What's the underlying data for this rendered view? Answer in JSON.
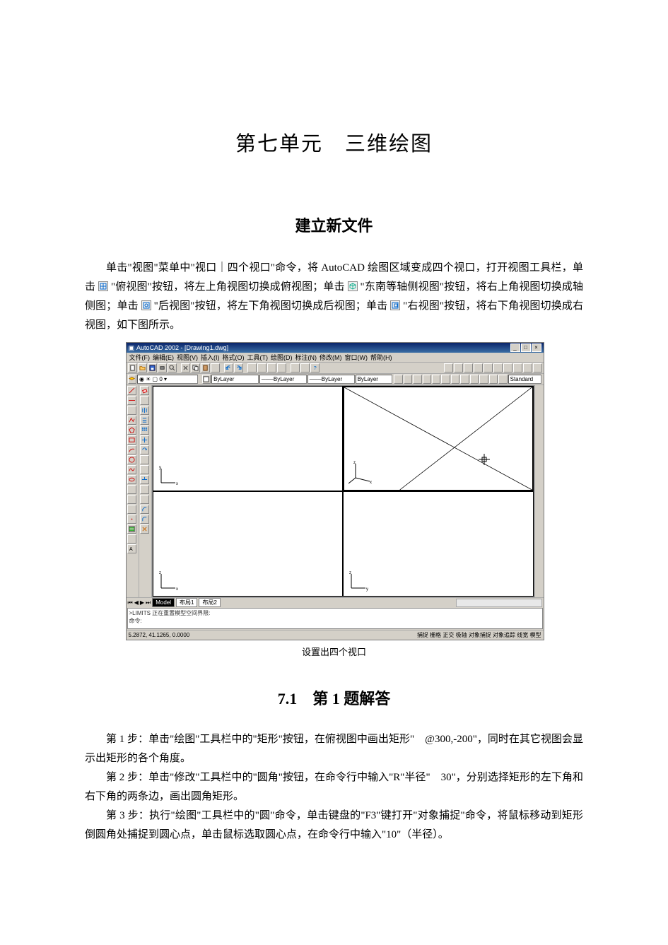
{
  "unit_title": "第七单元　三维绘图",
  "subtitle": "建立新文件",
  "intro": {
    "p1a": "单击\"视图\"菜单中\"视口｜四个视口\"命令，将 AutoCAD 绘图区域变成四个视口，打开视图工具栏，单击",
    "p1b": "\"俯视图\"按钮，将左上角视图切换成俯视图；单击",
    "p1c": "\"东南等轴侧视图\"按钮，将右上角视图切换成轴侧图；单击",
    "p1d": "\"后视图\"按钮，将左下角视图切换成后视图；单击",
    "p1e": "\"右视图\"按钮，将右下角视图切换成右视图，如下图所示。"
  },
  "figure_caption": "设置出四个视口",
  "section_title": "7.1　第 1 题解答",
  "steps": {
    "s1": "第 1 步：单击\"绘图\"工具栏中的\"矩形\"按钮，在俯视图中画出矩形\"　@300,-200\"，同时在其它视图会显示出矩形的各个角度。",
    "s2": "第 2 步：单击\"修改\"工具栏中的\"圆角\"按钮，在命令行中输入\"R\"半径\"　30\"，分别选择矩形的左下角和右下角的两条边，画出圆角矩形。",
    "s3": "第 3 步：执行\"绘图\"工具栏中的\"圆\"命令，单击键盘的\"F3\"键打开\"对象捕捉\"命令，将鼠标移动到矩形倒圆角处捕捉到圆心点，单击鼠标选取圆心点，在命令行中输入\"10\"（半径）。"
  },
  "cad": {
    "title": "AutoCAD 2002 - [Drawing1.dwg]",
    "menu": [
      "文件(F)",
      "编辑(E)",
      "视图(V)",
      "插入(I)",
      "格式(O)",
      "工具(T)",
      "绘图(D)",
      "标注(N)",
      "修改(M)",
      "窗口(W)",
      "帮助(H)"
    ],
    "layer_input": "ByLayer",
    "color_input": "ByLayer",
    "lt_input": "ByLayer",
    "lw_input": "ByLayer",
    "style_input": "Standard",
    "tabs": [
      "Model",
      "布局1",
      "布局2"
    ],
    "cmd_line1": ">LIMITS 正在重置模型空间界限:",
    "cmd_line2": "命令:",
    "coords": "5.2872, 41.1265, 0.0000",
    "status_buttons": "捕捉 栅格 正交 极轴 对象捕捉 对象追踪 线宽 模型"
  }
}
